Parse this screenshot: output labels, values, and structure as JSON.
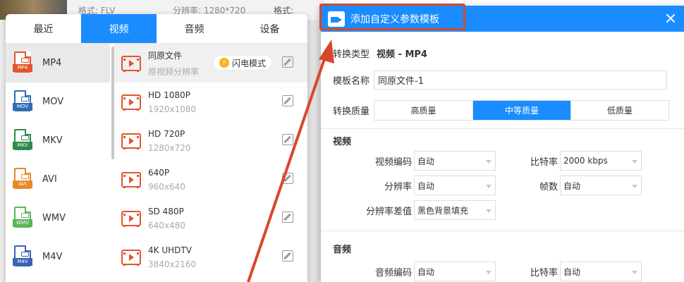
{
  "background": {
    "format_label": "格式: FLV",
    "resolution_label": "分辨率: 1280*720",
    "side_label": "格式:"
  },
  "format_panel": {
    "tabs": [
      {
        "label": "最近",
        "active": false
      },
      {
        "label": "视频",
        "active": true
      },
      {
        "label": "音频",
        "active": false
      },
      {
        "label": "设备",
        "active": false
      }
    ],
    "formats": [
      {
        "name": "MP4",
        "tag": "MP4",
        "color": "#e2552e",
        "active": true
      },
      {
        "name": "MOV",
        "tag": "MOV",
        "color": "#2e6db4",
        "active": false
      },
      {
        "name": "MKV",
        "tag": "MKV",
        "color": "#2e8b4a",
        "active": false
      },
      {
        "name": "AVI",
        "tag": "AVI",
        "color": "#e88a2a",
        "active": false
      },
      {
        "name": "WMV",
        "tag": "WMV",
        "color": "#5bb55b",
        "active": false
      },
      {
        "name": "M4V",
        "tag": "M4V",
        "color": "#3a64b0",
        "active": false
      }
    ],
    "presets": [
      {
        "name": "同原文件",
        "sub": "原视频分辨率",
        "active": true
      },
      {
        "name": "HD 1080P",
        "sub": "1920x1080",
        "active": false
      },
      {
        "name": "HD 720P",
        "sub": "1280x720",
        "active": false
      },
      {
        "name": "640P",
        "sub": "960x640",
        "active": false
      },
      {
        "name": "SD 480P",
        "sub": "640x480",
        "active": false
      },
      {
        "name": "4K UHDTV",
        "sub": "3840x2160",
        "active": false
      }
    ],
    "flash_mode_label": "闪电模式"
  },
  "dialog": {
    "title": "添加自定义参数模板",
    "convert_type_label": "转换类型",
    "convert_type_value": "视频 - MP4",
    "template_name_label": "模板名称",
    "template_name_value": "同原文件-1",
    "quality_label": "转换质量",
    "quality_options": [
      {
        "label": "高质量",
        "active": false
      },
      {
        "label": "中等质量",
        "active": true
      },
      {
        "label": "低质量",
        "active": false
      }
    ],
    "video_section": "视频",
    "video_fields": {
      "codec_label": "视频编码",
      "codec_value": "自动",
      "bitrate_label": "比特率",
      "bitrate_value": "2000 kbps",
      "resolution_label": "分辨率",
      "resolution_value": "自动",
      "fps_label": "帧数",
      "fps_value": "自动",
      "res_diff_label": "分辨率差值",
      "res_diff_value": "黑色背景填充"
    },
    "audio_section": "音频",
    "audio_fields": {
      "codec_label": "音频编码",
      "codec_value": "自动",
      "bitrate_label": "比特率",
      "bitrate_value": "自动"
    }
  },
  "colors": {
    "accent": "#1a8cff",
    "annotation": "#d9472b"
  }
}
